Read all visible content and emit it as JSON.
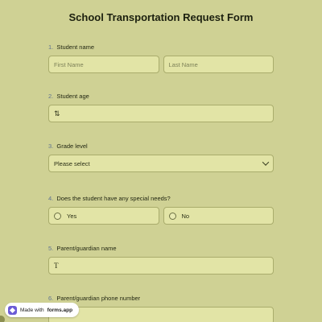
{
  "form": {
    "title": "School Transportation Request Form"
  },
  "questions": {
    "q1": {
      "number": "1.",
      "label": "Student name",
      "first_placeholder": "First Name",
      "last_placeholder": "Last Name"
    },
    "q2": {
      "number": "2.",
      "label": "Student age",
      "icon_glyph": "⇅"
    },
    "q3": {
      "number": "3.",
      "label": "Grade level",
      "select_value": "Please select"
    },
    "q4": {
      "number": "4.",
      "label": "Does the student have any special needs?",
      "options": [
        "Yes",
        "No"
      ]
    },
    "q5": {
      "number": "5.",
      "label": "Parent/guardian name",
      "icon_glyph": "T"
    },
    "q6": {
      "number": "6.",
      "label": "Parent/guardian phone number"
    }
  },
  "badge": {
    "prefix": "Made with",
    "brand": "forms.app"
  },
  "colors": {
    "background": "#cfd194",
    "field": "#e2e4a6",
    "number_accent": "#5f7390",
    "badge_logo": "#6b5bd6"
  }
}
